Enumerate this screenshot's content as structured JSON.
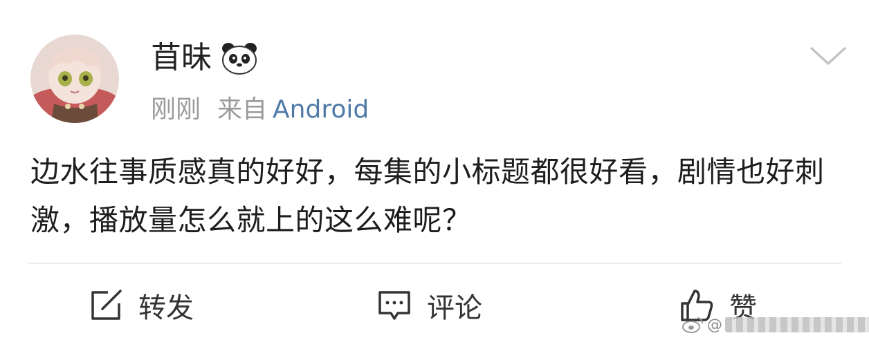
{
  "post": {
    "author": {
      "name": "苜昧",
      "avatar_icon": "anime-avatar-icon",
      "badge_icon": "panda-icon"
    },
    "time": "刚刚",
    "source_label": "来自",
    "device": "Android",
    "content": "边水往事质感真的好好，每集的小标题都很好看，剧情也好刺激，播放量怎么就上的这么难呢？"
  },
  "actions": {
    "repost_label": "转发",
    "comment_label": "评论",
    "like_label": "赞"
  },
  "watermark": {
    "prefix": "@"
  },
  "colors": {
    "device_link": "#4f7aa8",
    "meta_gray": "#9a9a9a",
    "text": "#1d1d1d"
  }
}
